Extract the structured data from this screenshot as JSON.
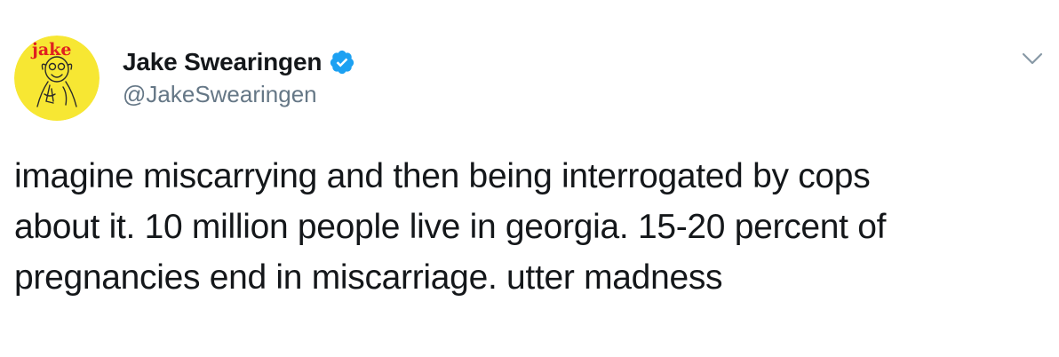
{
  "tweet": {
    "display_name": "Jake Swearingen",
    "handle": "@JakeSwearingen",
    "avatar_text": "jake",
    "text_lines": [
      "imagine miscarrying and then being interrogated by cops",
      "about it. 10 million people live in georgia. 15-20 percent of",
      "pregnancies end in miscarriage. utter madness"
    ]
  },
  "icons": {
    "verified": "verified-badge-icon",
    "menu": "chevron-down-icon"
  },
  "colors": {
    "verified_blue": "#1da1f2",
    "handle_gray": "#657786",
    "avatar_yellow": "#f7e733",
    "avatar_red": "#e02020"
  }
}
